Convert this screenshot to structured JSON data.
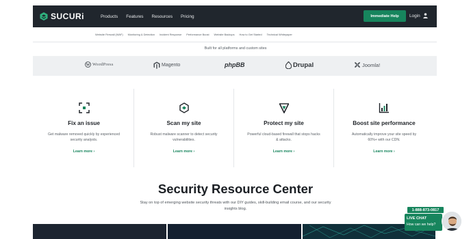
{
  "header": {
    "logo_text": "SUCURi",
    "nav": [
      "Products",
      "Features",
      "Resources",
      "Pricing"
    ],
    "cta_label": "Immediate Help",
    "login_label": "Login"
  },
  "subnav": [
    "Website Firewall (WAF)",
    "Monitoring & Detection",
    "Incident Response",
    "Performance Boost",
    "Website Backups",
    "How to Get Started",
    "Technical Whitepaper"
  ],
  "platforms": {
    "tagline": "Built for all platforms and custom sites",
    "items": [
      "WordPress",
      "Magento",
      "phpBB",
      "Drupal",
      "Joomla!"
    ]
  },
  "features": [
    {
      "title": "Fix an issue",
      "desc": "Get malware removed quickly by experienced security analysts.",
      "link": "Learn more"
    },
    {
      "title": "Scan my site",
      "desc": "Robust malware scanner to detect security vulnerabilities.",
      "link": "Learn more"
    },
    {
      "title": "Protect my site",
      "desc": "Powerful cloud-based firewall that stops hacks & attacks.",
      "link": "Learn more"
    },
    {
      "title": "Boost site performance",
      "desc": "Automatically improve your site speed by 60%+ with our CDN.",
      "link": "Learn more"
    }
  ],
  "resource_center": {
    "title": "Security Resource Center",
    "desc": "Stay on top of emerging website security threats with our DIY guides, skill-building email course, and our security insights blog."
  },
  "chat": {
    "phone": "1-888-873-0817",
    "title": "LIVE CHAT",
    "subtitle": "How can we help?"
  },
  "colors": {
    "brand_green": "#17855d",
    "nav_dark": "#20262d",
    "platform_bg": "#eef0f2"
  }
}
